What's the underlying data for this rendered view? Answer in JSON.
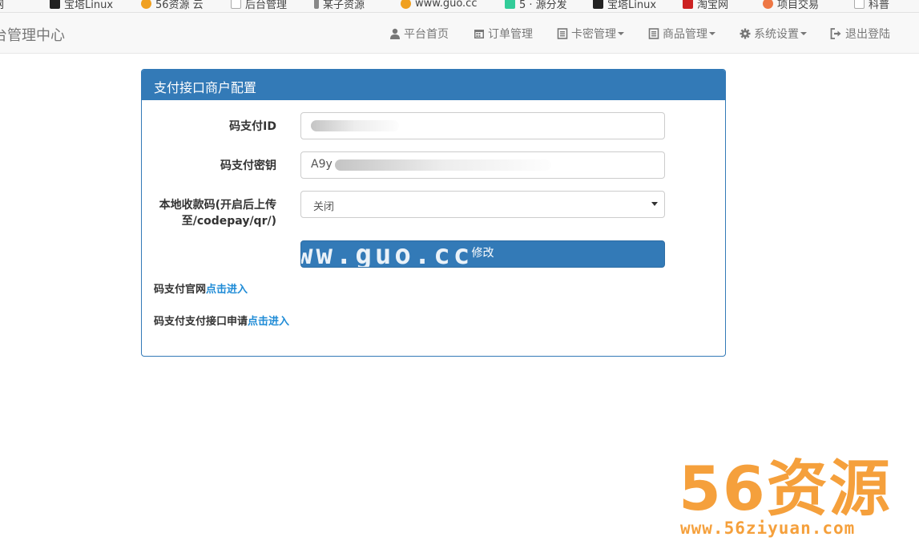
{
  "bookmarks": [
    {
      "label": "网",
      "color": "#cc3333"
    },
    {
      "label": "宝塔Linux",
      "color": "#222222"
    },
    {
      "label": "56资源 云",
      "color": "#f0a020"
    },
    {
      "label": "后台管理",
      "color": "#dddddd"
    },
    {
      "label": "某子资源",
      "color": "#888888"
    },
    {
      "label": "www.guo.cc",
      "color": "#f0a020"
    },
    {
      "label": "5 · 源分发",
      "color": "#33cc99"
    },
    {
      "label": "宝塔Linux",
      "color": "#222222"
    },
    {
      "label": "淘宝网",
      "color": "#cc2222"
    },
    {
      "label": "项目交易",
      "color": "#ee7744"
    },
    {
      "label": "科普",
      "color": "#dddddd"
    }
  ],
  "navbar": {
    "brand": "台管理中心",
    "items": [
      {
        "label": "平台首页",
        "icon": "user-icon",
        "dropdown": false
      },
      {
        "label": "订单管理",
        "icon": "calendar-icon",
        "dropdown": false
      },
      {
        "label": "卡密管理",
        "icon": "list-alt-icon",
        "dropdown": true
      },
      {
        "label": "商品管理",
        "icon": "list-alt-icon",
        "dropdown": true
      },
      {
        "label": "系统设置",
        "icon": "gear-icon",
        "dropdown": true
      },
      {
        "label": "退出登陆",
        "icon": "log-out-icon",
        "dropdown": false
      }
    ]
  },
  "panel": {
    "title": "支付接口商户配置",
    "fields": {
      "pay_id_label": "码支付ID",
      "pay_id_value": "",
      "pay_key_label": "码支付密钥",
      "pay_key_value": "A9y",
      "local_qr_label_line1": "本地收款码(开启后上传",
      "local_qr_label_line2": "至/codepay/qr/)",
      "local_qr_value": "关闭"
    },
    "submit_label": "修改",
    "submit_overlay_text": "ww.guo.cc",
    "links": [
      {
        "text": "码支付官网",
        "link": "点击进入"
      },
      {
        "text": "码支付支付接口申请",
        "link": "点击进入"
      }
    ]
  },
  "watermark": {
    "big": "56资源",
    "url": "www.56ziyuan.com"
  },
  "colors": {
    "primary": "#337ab7",
    "link": "#1e8bd6",
    "watermark": "#f5a03c"
  }
}
